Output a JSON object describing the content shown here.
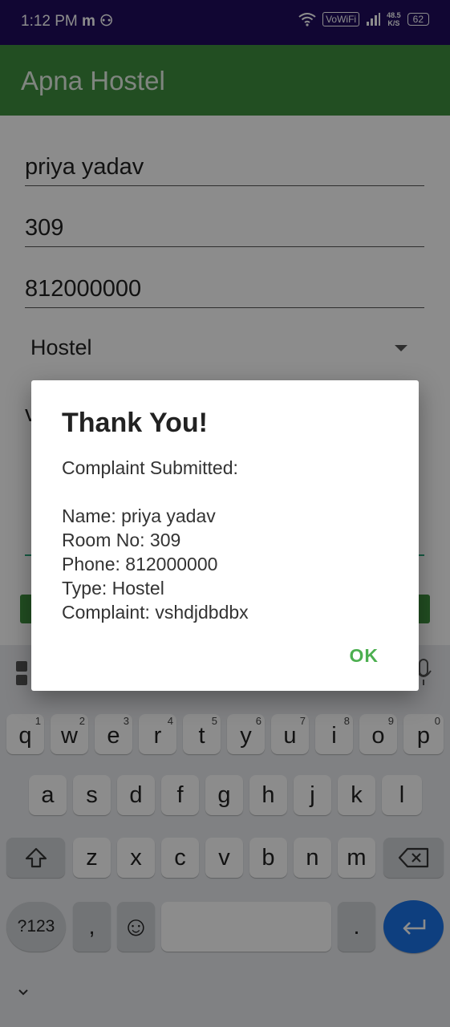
{
  "status_bar": {
    "time": "1:12 PM",
    "app_icons_text": "m ⚇",
    "vowifi": "VoWiFi",
    "speed_value": "48.5",
    "speed_unit": "K/S",
    "battery": "62"
  },
  "app_bar": {
    "title": "Apna Hostel"
  },
  "form": {
    "name_value": "priya yadav",
    "room_value": "309",
    "phone_value": "812000000",
    "type_selected": "Hostel",
    "complaint_partial": "v"
  },
  "dialog": {
    "title": "Thank You!",
    "lines": [
      "Complaint Submitted:",
      "",
      "Name: priya yadav",
      "Room No: 309",
      "Phone: 812000000",
      "Type: Hostel",
      "Complaint: vshdjdbdbx"
    ],
    "ok_label": "OK"
  },
  "keyboard": {
    "row1": [
      {
        "k": "q",
        "h": "1"
      },
      {
        "k": "w",
        "h": "2"
      },
      {
        "k": "e",
        "h": "3"
      },
      {
        "k": "r",
        "h": "4"
      },
      {
        "k": "t",
        "h": "5"
      },
      {
        "k": "y",
        "h": "6"
      },
      {
        "k": "u",
        "h": "7"
      },
      {
        "k": "i",
        "h": "8"
      },
      {
        "k": "o",
        "h": "9"
      },
      {
        "k": "p",
        "h": "0"
      }
    ],
    "row2": [
      "a",
      "s",
      "d",
      "f",
      "g",
      "h",
      "j",
      "k",
      "l"
    ],
    "row3": [
      "z",
      "x",
      "c",
      "v",
      "b",
      "n",
      "m"
    ],
    "symbols_key": "?123",
    "comma_key": ",",
    "period_key": ".",
    "emoji_key": "☺"
  }
}
